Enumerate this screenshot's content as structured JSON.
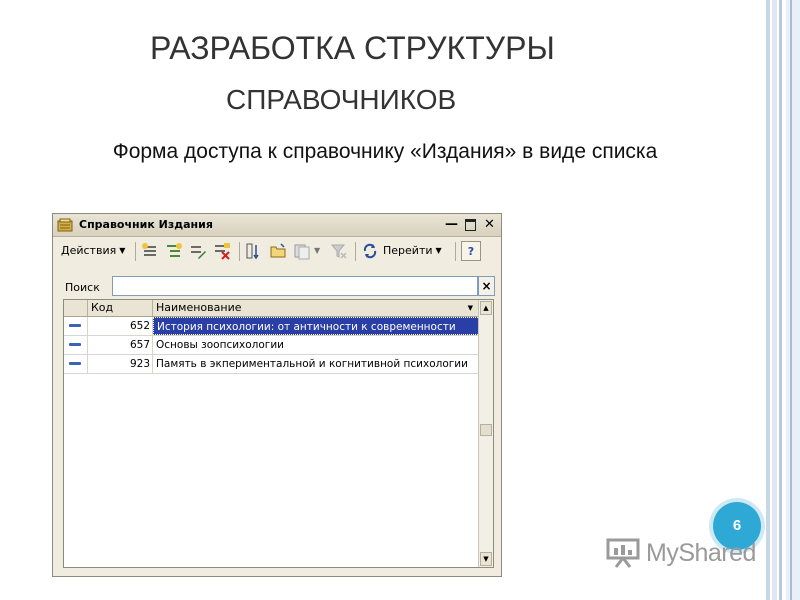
{
  "slide": {
    "title_line1": "Разработка структуры",
    "title_line2": "справочников",
    "subtitle": "Форма доступа к справочнику «Издания» в виде списка",
    "page_number": "6"
  },
  "window": {
    "title": "Справочник Издания",
    "controls": {
      "minimize": "—",
      "close": "✕"
    }
  },
  "toolbar": {
    "actions_label": "Действия",
    "goto_label": "Перейти",
    "help_label": "?",
    "icons": [
      "add-icon",
      "add-group-icon",
      "edit-icon",
      "delete-mark-icon",
      "hierarchy-icon",
      "folder-icon",
      "copy-icon",
      "filter-off-icon",
      "refresh-icon"
    ]
  },
  "search": {
    "label": "Поиск",
    "value": "",
    "clear_label": "×"
  },
  "table": {
    "columns": [
      "Код",
      "Наименование"
    ],
    "sort_marker": "▼",
    "rows": [
      {
        "code": "652",
        "name": "История психологии: от античности к современности",
        "selected": true
      },
      {
        "code": "657",
        "name": "Основы зоопсихологии",
        "selected": false
      },
      {
        "code": "923",
        "name": "Память в экпериментальной и когнитивной психологии",
        "selected": false
      }
    ]
  },
  "watermark": {
    "text": "MyShared"
  },
  "colors": {
    "accent": "#2ea8d4",
    "selection": "#2a3fa6",
    "window_bg": "#f0ece0"
  }
}
